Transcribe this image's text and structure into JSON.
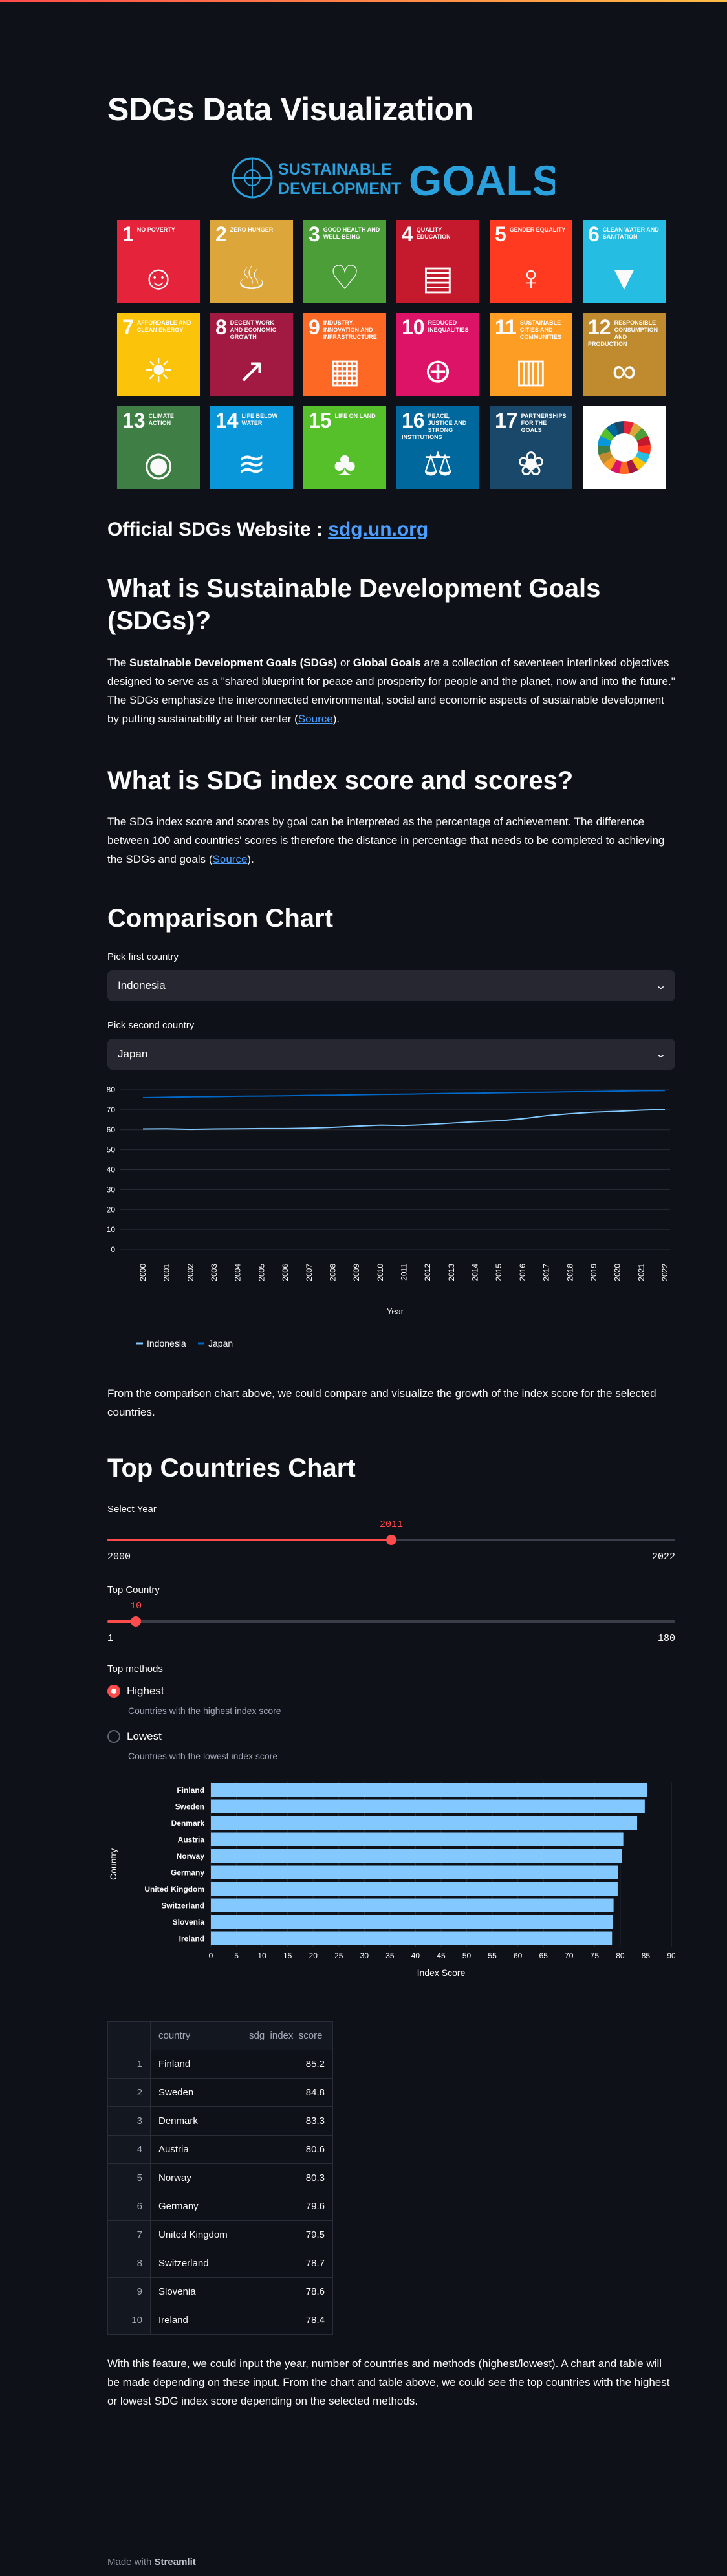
{
  "page": {
    "title": "SDGs Data Visualization",
    "logo_line1": "SUSTAINABLE",
    "logo_line2": "DEVELOPMENT",
    "logo_goals": "GOALS"
  },
  "goals": [
    {
      "num": "1",
      "label": "No poverty",
      "color": "#e5243b",
      "icon": "☺"
    },
    {
      "num": "2",
      "label": "Zero hunger",
      "color": "#dda63a",
      "icon": "♨"
    },
    {
      "num": "3",
      "label": "Good health and well-being",
      "color": "#4c9f38",
      "icon": "♡"
    },
    {
      "num": "4",
      "label": "Quality education",
      "color": "#c5192d",
      "icon": "▤"
    },
    {
      "num": "5",
      "label": "Gender equality",
      "color": "#ff3a21",
      "icon": "♀"
    },
    {
      "num": "6",
      "label": "Clean water and sanitation",
      "color": "#26bde2",
      "icon": "▼"
    },
    {
      "num": "7",
      "label": "Affordable and clean energy",
      "color": "#fcc30b",
      "icon": "☀"
    },
    {
      "num": "8",
      "label": "Decent work and economic growth",
      "color": "#a21942",
      "icon": "↗"
    },
    {
      "num": "9",
      "label": "Industry, innovation and infrastructure",
      "color": "#fd6925",
      "icon": "▦"
    },
    {
      "num": "10",
      "label": "Reduced inequalities",
      "color": "#dd1367",
      "icon": "⊕"
    },
    {
      "num": "11",
      "label": "Sustainable cities and communities",
      "color": "#fd9d24",
      "icon": "▥"
    },
    {
      "num": "12",
      "label": "Responsible consumption and production",
      "color": "#bf8b2e",
      "icon": "∞"
    },
    {
      "num": "13",
      "label": "Climate action",
      "color": "#3f7e44",
      "icon": "◉"
    },
    {
      "num": "14",
      "label": "Life below water",
      "color": "#0a97d9",
      "icon": "≋"
    },
    {
      "num": "15",
      "label": "Life on land",
      "color": "#56c02b",
      "icon": "♣"
    },
    {
      "num": "16",
      "label": "Peace, justice and strong institutions",
      "color": "#00689d",
      "icon": "⚖"
    },
    {
      "num": "17",
      "label": "Partnerships for the goals",
      "color": "#19486a",
      "icon": "❀"
    }
  ],
  "official": {
    "label": "Official SDGs Website :",
    "link": "sdg.un.org"
  },
  "section_what": {
    "heading": "What is Sustainable Development Goals (SDGs)?",
    "p1": "The ",
    "b1": "Sustainable Development Goals (SDGs)",
    "p2": " or ",
    "b2": "Global Goals",
    "p3": " are a collection of seventeen interlinked objectives designed to serve as a \"shared blueprint for peace and prosperity for people and the planet, now and into the future.\" The SDGs emphasize the interconnected environmental, social and economic aspects of sustainable development by putting sustainability at their center (",
    "source": "Source",
    "p4": ")."
  },
  "section_index": {
    "heading": "What is SDG index score and scores?",
    "p1": "The SDG index score and scores by goal can be interpreted as the percentage of achievement. The difference between 100 and countries' scores is therefore the distance in percentage that needs to be completed to achieving the SDGs and goals (",
    "source": "Source",
    "p2": ")."
  },
  "comparison": {
    "heading": "Comparison Chart",
    "first_label": "Pick first country",
    "first_value": "Indonesia",
    "second_label": "Pick second country",
    "second_value": "Japan",
    "after_text": "From the comparison chart above, we could compare and visualize the growth of the index score for the selected countries."
  },
  "top": {
    "heading": "Top Countries Chart",
    "year_label": "Select Year",
    "year_value": "2011",
    "year_value_num": 2011,
    "year_min": "2000",
    "year_max": "2022",
    "year_min_num": 2000,
    "year_max_num": 2022,
    "count_label": "Top Country",
    "count_value": "10",
    "count_value_num": 10,
    "count_min": "1",
    "count_max": "180",
    "count_min_num": 1,
    "count_max_num": 180,
    "methods_label": "Top methods",
    "highest_label": "Highest",
    "highest_caption": "Countries with the highest index score",
    "lowest_label": "Lowest",
    "lowest_caption": "Countries with the lowest index score",
    "table_headers": [
      "",
      "country",
      "sdg_index_score"
    ],
    "table_rows": [
      [
        "1",
        "Finland",
        "85.2"
      ],
      [
        "2",
        "Sweden",
        "84.8"
      ],
      [
        "3",
        "Denmark",
        "83.3"
      ],
      [
        "4",
        "Austria",
        "80.6"
      ],
      [
        "5",
        "Norway",
        "80.3"
      ],
      [
        "6",
        "Germany",
        "79.6"
      ],
      [
        "7",
        "United Kingdom",
        "79.5"
      ],
      [
        "8",
        "Switzerland",
        "78.7"
      ],
      [
        "9",
        "Slovenia",
        "78.6"
      ],
      [
        "10",
        "Ireland",
        "78.4"
      ]
    ],
    "after_text": "With this feature, we could input the year, number of countries and methods (highest/lowest). A chart and table will be made depending on these input. From the chart and table above, we could see the top countries with the highest or lowest SDG index score depending on the selected methods."
  },
  "footer": {
    "made_with": "Made with ",
    "brand": "Streamlit"
  },
  "chart_data": [
    {
      "type": "line",
      "x": [
        "2000",
        "2001",
        "2002",
        "2003",
        "2004",
        "2005",
        "2006",
        "2007",
        "2008",
        "2009",
        "2010",
        "2011",
        "2012",
        "2013",
        "2014",
        "2015",
        "2016",
        "2017",
        "2018",
        "2019",
        "2020",
        "2021",
        "2022"
      ],
      "series": [
        {
          "name": "Indonesia",
          "color": "#83c9ff",
          "values": [
            60.4,
            60.5,
            60.2,
            60.4,
            60.5,
            60.6,
            60.6,
            60.8,
            61.2,
            61.8,
            62.3,
            62.1,
            62.6,
            63.3,
            64.0,
            64.5,
            65.5,
            67.0,
            68.0,
            68.8,
            69.2,
            69.8,
            70.2
          ]
        },
        {
          "name": "Japan",
          "color": "#0068c9",
          "values": [
            76.1,
            76.3,
            76.5,
            76.6,
            76.8,
            76.9,
            77.0,
            77.2,
            77.3,
            77.5,
            77.7,
            77.8,
            78.0,
            78.2,
            78.3,
            78.5,
            78.7,
            78.8,
            79.0,
            79.1,
            79.3,
            79.5,
            79.6
          ]
        }
      ],
      "xlabel": "Year",
      "yticks": [
        "0",
        "10",
        "20",
        "30",
        "40",
        "50",
        "60",
        "70",
        "80"
      ],
      "ylim": [
        0,
        80
      ],
      "grid": true,
      "legend": "bottom-left"
    },
    {
      "type": "bar",
      "orientation": "horizontal",
      "categories": [
        "Finland",
        "Sweden",
        "Denmark",
        "Austria",
        "Norway",
        "Germany",
        "United Kingdom",
        "Switzerland",
        "Slovenia",
        "Ireland"
      ],
      "values": [
        85.2,
        84.8,
        83.3,
        80.6,
        80.3,
        79.6,
        79.5,
        78.7,
        78.6,
        78.4
      ],
      "color": "#83c9ff",
      "xlabel": "Index Score",
      "ylabel": "Country",
      "xticks": [
        "0",
        "5",
        "10",
        "15",
        "20",
        "25",
        "30",
        "35",
        "40",
        "45",
        "50",
        "55",
        "60",
        "65",
        "70",
        "75",
        "80",
        "85",
        "90"
      ],
      "xlim": [
        0,
        90
      ],
      "grid": true
    }
  ]
}
